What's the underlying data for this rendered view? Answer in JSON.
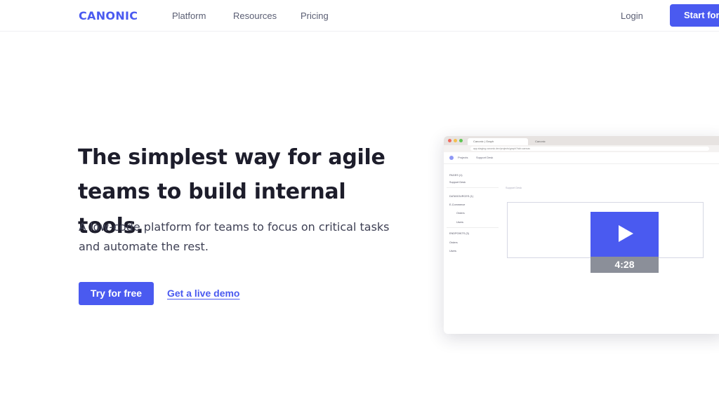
{
  "nav": {
    "logo": "CANONIC",
    "links": [
      "Platform",
      "Resources",
      "Pricing"
    ],
    "login": "Login",
    "cta": "Start for"
  },
  "hero": {
    "headline_line1": "The simplest way for agile",
    "headline_line2": "teams to build internal tools.",
    "subtext_line1": "A low-code platform for teams to focus on critical tasks",
    "subtext_line2": "and automate the rest.",
    "primary_button": "Try for free",
    "secondary_link": "Get a live demo"
  },
  "mockup": {
    "tabs": [
      "Canonic | Graph",
      "Canonic"
    ],
    "url": "app.staging.canonic.dev/projects/graph?tab=canvas",
    "app_breadcrumb": [
      "Projects",
      "Support Desk"
    ],
    "sidebar": {
      "pages_header": "PAGES (1)",
      "page_item": "Support Desk",
      "datasources_header": "DATASOURCES (1)",
      "datasource_item": "E-Commerce",
      "datasource_children": [
        "Orders",
        "Users"
      ],
      "endpoints_header": "ENDPOINTS (3)",
      "endpoint_items": [
        "Orders",
        "Users"
      ]
    },
    "canvas_label": "Support Desk",
    "video_duration": "4:28"
  },
  "colors": {
    "brand": "#4a5af0",
    "text_dark": "#1d1d2b",
    "video_bar": "#8b8f99"
  }
}
